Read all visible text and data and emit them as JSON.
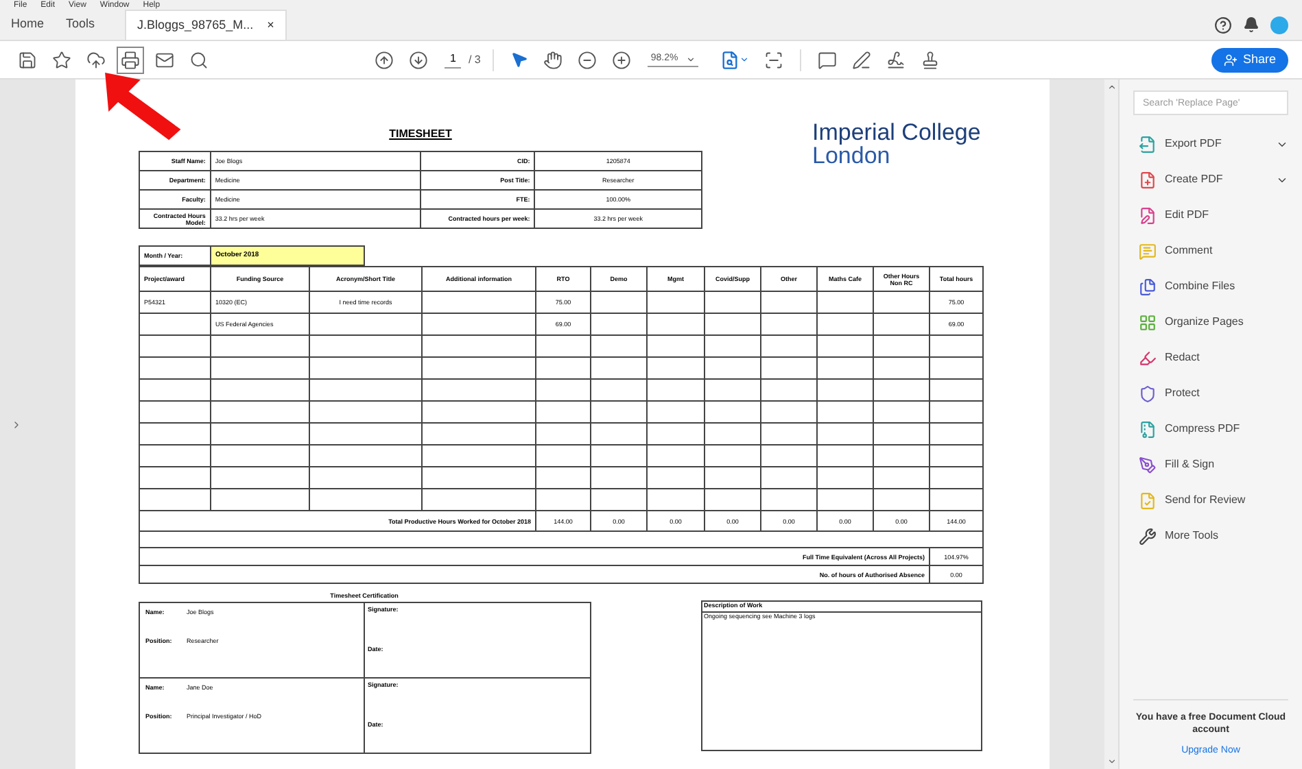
{
  "menu_bar": [
    "File",
    "Edit",
    "View",
    "Window",
    "Help"
  ],
  "tabs": [
    {
      "label": "Home",
      "selected": false
    },
    {
      "label": "Tools",
      "selected": false
    },
    {
      "label": "J.Bloggs_98765_M...",
      "selected": true,
      "close": "×"
    }
  ],
  "toolbar": {
    "page": "1",
    "page_total": "/ 3",
    "zoom": "98.2%"
  },
  "share_button": "Share",
  "document": {
    "title": "TIMESHEET",
    "staff": [
      [
        "Staff Name:",
        "Joe Blogs",
        "CID:",
        "1205874"
      ],
      [
        "Department:",
        "Medicine",
        "Post Title:",
        "Researcher"
      ],
      [
        "Faculty:",
        "Medicine",
        "FTE:",
        "100.00%"
      ],
      [
        "Contracted Hours Model:",
        "33.2 hrs per week",
        "Contracted hours per week:",
        "33.2 hrs per week"
      ]
    ],
    "logo": [
      "Imperial College",
      "London"
    ],
    "month_label": "Month / Year:",
    "month": "October 2018",
    "columns": [
      "Project/award",
      "Funding Source",
      "Acronym/Short Title",
      "Additional information",
      "RTO",
      "Demo",
      "Mgmt",
      "Covid/Supp",
      "Other",
      "Maths Cafe",
      "Other Hours Non RC",
      "Total hours"
    ],
    "rows": [
      [
        "P54321",
        "10320 (EC)",
        "I need time records",
        "",
        "75.00",
        "",
        "",
        "",
        "",
        "",
        "",
        "75.00"
      ],
      [
        "",
        "US Federal Agencies",
        "",
        "",
        "69.00",
        "",
        "",
        "",
        "",
        "",
        "",
        "69.00"
      ],
      [
        "",
        "",
        "",
        "",
        "",
        "",
        "",
        "",
        "",
        "",
        "",
        ""
      ],
      [
        "",
        "",
        "",
        "",
        "",
        "",
        "",
        "",
        "",
        "",
        "",
        ""
      ],
      [
        "",
        "",
        "",
        "",
        "",
        "",
        "",
        "",
        "",
        "",
        "",
        ""
      ],
      [
        "",
        "",
        "",
        "",
        "",
        "",
        "",
        "",
        "",
        "",
        "",
        ""
      ],
      [
        "",
        "",
        "",
        "",
        "",
        "",
        "",
        "",
        "",
        "",
        "",
        ""
      ],
      [
        "",
        "",
        "",
        "",
        "",
        "",
        "",
        "",
        "",
        "",
        "",
        ""
      ],
      [
        "",
        "",
        "",
        "",
        "",
        "",
        "",
        "",
        "",
        "",
        "",
        ""
      ],
      [
        "",
        "",
        "",
        "",
        "",
        "",
        "",
        "",
        "",
        "",
        "",
        ""
      ]
    ],
    "total_label": "Total Productive Hours Worked for October 2018",
    "totals": [
      "144.00",
      "0.00",
      "0.00",
      "0.00",
      "0.00",
      "0.00",
      "0.00",
      "144.00"
    ],
    "summary": [
      {
        "label": "Full Time Equivalent (Across All Projects)",
        "value": "104.97%"
      },
      {
        "label": "No. of hours of Authorised Absence",
        "value": "0.00"
      }
    ],
    "certification_title": "Timesheet Certification",
    "signers": [
      {
        "name_label": "Name:",
        "name": "Joe Blogs",
        "position_label": "Position:",
        "position": "Researcher",
        "signature_label": "Signature:",
        "date_label": "Date:"
      },
      {
        "name_label": "Name:",
        "name": "Jane Doe",
        "position_label": "Position:",
        "position": "Principal Investigator / HoD",
        "signature_label": "Signature:",
        "date_label": "Date:"
      }
    ],
    "description_title": "Description of Work",
    "description": "Ongoing sequencing see Machine 3 logs"
  },
  "tools_panel": {
    "search": {
      "placeholder": "Search 'Replace Page'"
    },
    "items": [
      {
        "label": "Export PDF",
        "color": "#2aa3a0",
        "has_menu": true
      },
      {
        "label": "Create PDF",
        "color": "#e0474c",
        "has_menu": true
      },
      {
        "label": "Edit PDF",
        "color": "#d9408f",
        "has_menu": false
      },
      {
        "label": "Comment",
        "color": "#e3b81e",
        "has_menu": false
      },
      {
        "label": "Combine Files",
        "color": "#4a5bd8",
        "has_menu": false
      },
      {
        "label": "Organize Pages",
        "color": "#5aae3c",
        "has_menu": false
      },
      {
        "label": "Redact",
        "color": "#d7336d",
        "has_menu": false
      },
      {
        "label": "Protect",
        "color": "#6c5fd0",
        "has_menu": false
      },
      {
        "label": "Compress PDF",
        "color": "#2aa3a0",
        "has_menu": false
      },
      {
        "label": "Fill & Sign",
        "color": "#8a4fd0",
        "has_menu": false
      },
      {
        "label": "Send for Review",
        "color": "#e3b81e",
        "has_menu": false
      },
      {
        "label": "More Tools",
        "color": "#444444",
        "has_menu": false
      }
    ],
    "promo": "You have a free Document Cloud account",
    "upgrade_link": "Upgrade Now"
  }
}
